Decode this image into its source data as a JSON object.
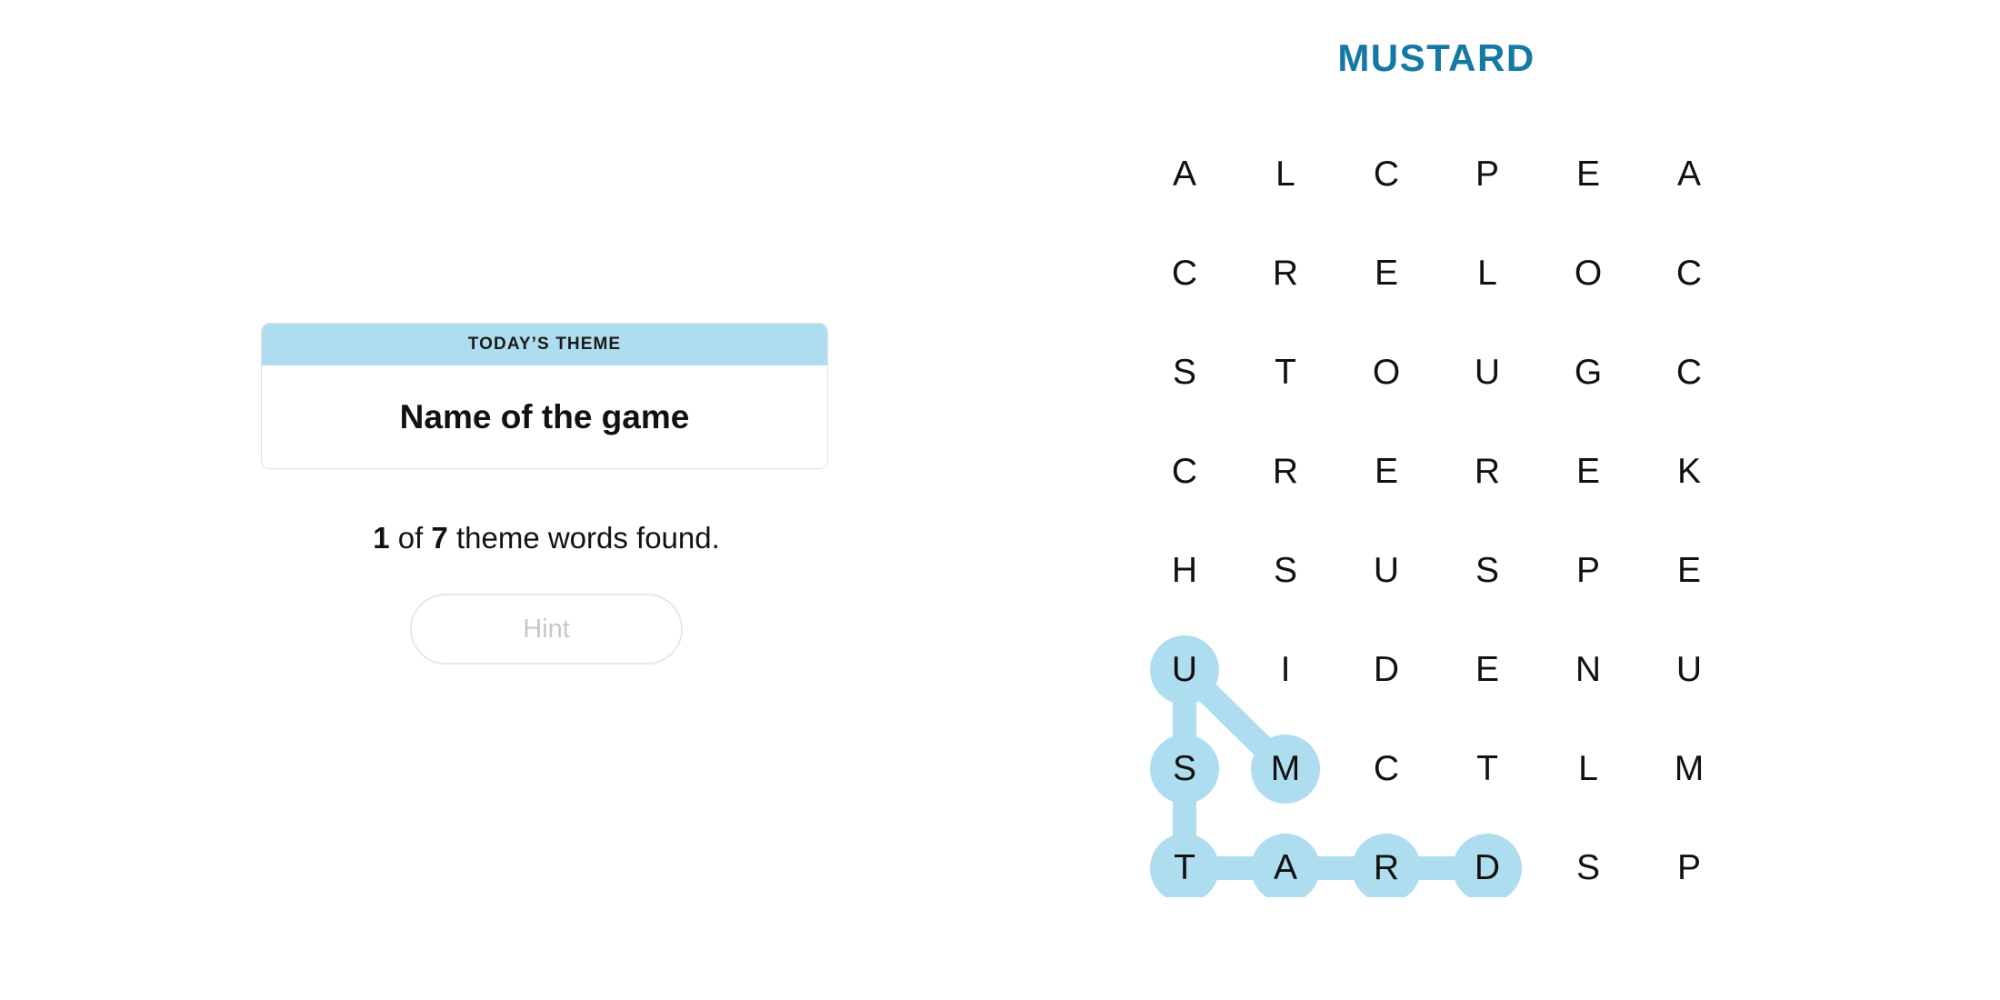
{
  "puzzle": {
    "title": "MUSTARD",
    "title_color": "#1479a4",
    "highlight_color": "#aeddef",
    "grid": {
      "rows": 8,
      "cols": 6,
      "letters": [
        [
          "A",
          "L",
          "C",
          "P",
          "E",
          "A"
        ],
        [
          "C",
          "R",
          "E",
          "L",
          "O",
          "C"
        ],
        [
          "S",
          "T",
          "O",
          "U",
          "G",
          "C"
        ],
        [
          "C",
          "R",
          "E",
          "R",
          "E",
          "K"
        ],
        [
          "H",
          "S",
          "U",
          "S",
          "P",
          "E"
        ],
        [
          "U",
          "I",
          "D",
          "E",
          "N",
          "U"
        ],
        [
          "S",
          "M",
          "C",
          "T",
          "L",
          "M"
        ],
        [
          "T",
          "A",
          "R",
          "D",
          "S",
          "P"
        ]
      ],
      "found_word_path": {
        "word": "MUSTARD",
        "cells": [
          {
            "row": 6,
            "col": 1,
            "letter": "M"
          },
          {
            "row": 5,
            "col": 0,
            "letter": "U"
          },
          {
            "row": 6,
            "col": 0,
            "letter": "S"
          },
          {
            "row": 7,
            "col": 0,
            "letter": "T"
          },
          {
            "row": 7,
            "col": 1,
            "letter": "A"
          },
          {
            "row": 7,
            "col": 2,
            "letter": "R"
          },
          {
            "row": 7,
            "col": 3,
            "letter": "D"
          }
        ]
      }
    }
  },
  "theme_card": {
    "header_label": "TODAY’S THEME",
    "theme_text": "Name of the game",
    "header_bg": "#aeddef"
  },
  "progress": {
    "found": "1",
    "connector": " of ",
    "total": "7",
    "suffix": " theme words found."
  },
  "hint": {
    "label": "Hint",
    "disabled": true
  }
}
